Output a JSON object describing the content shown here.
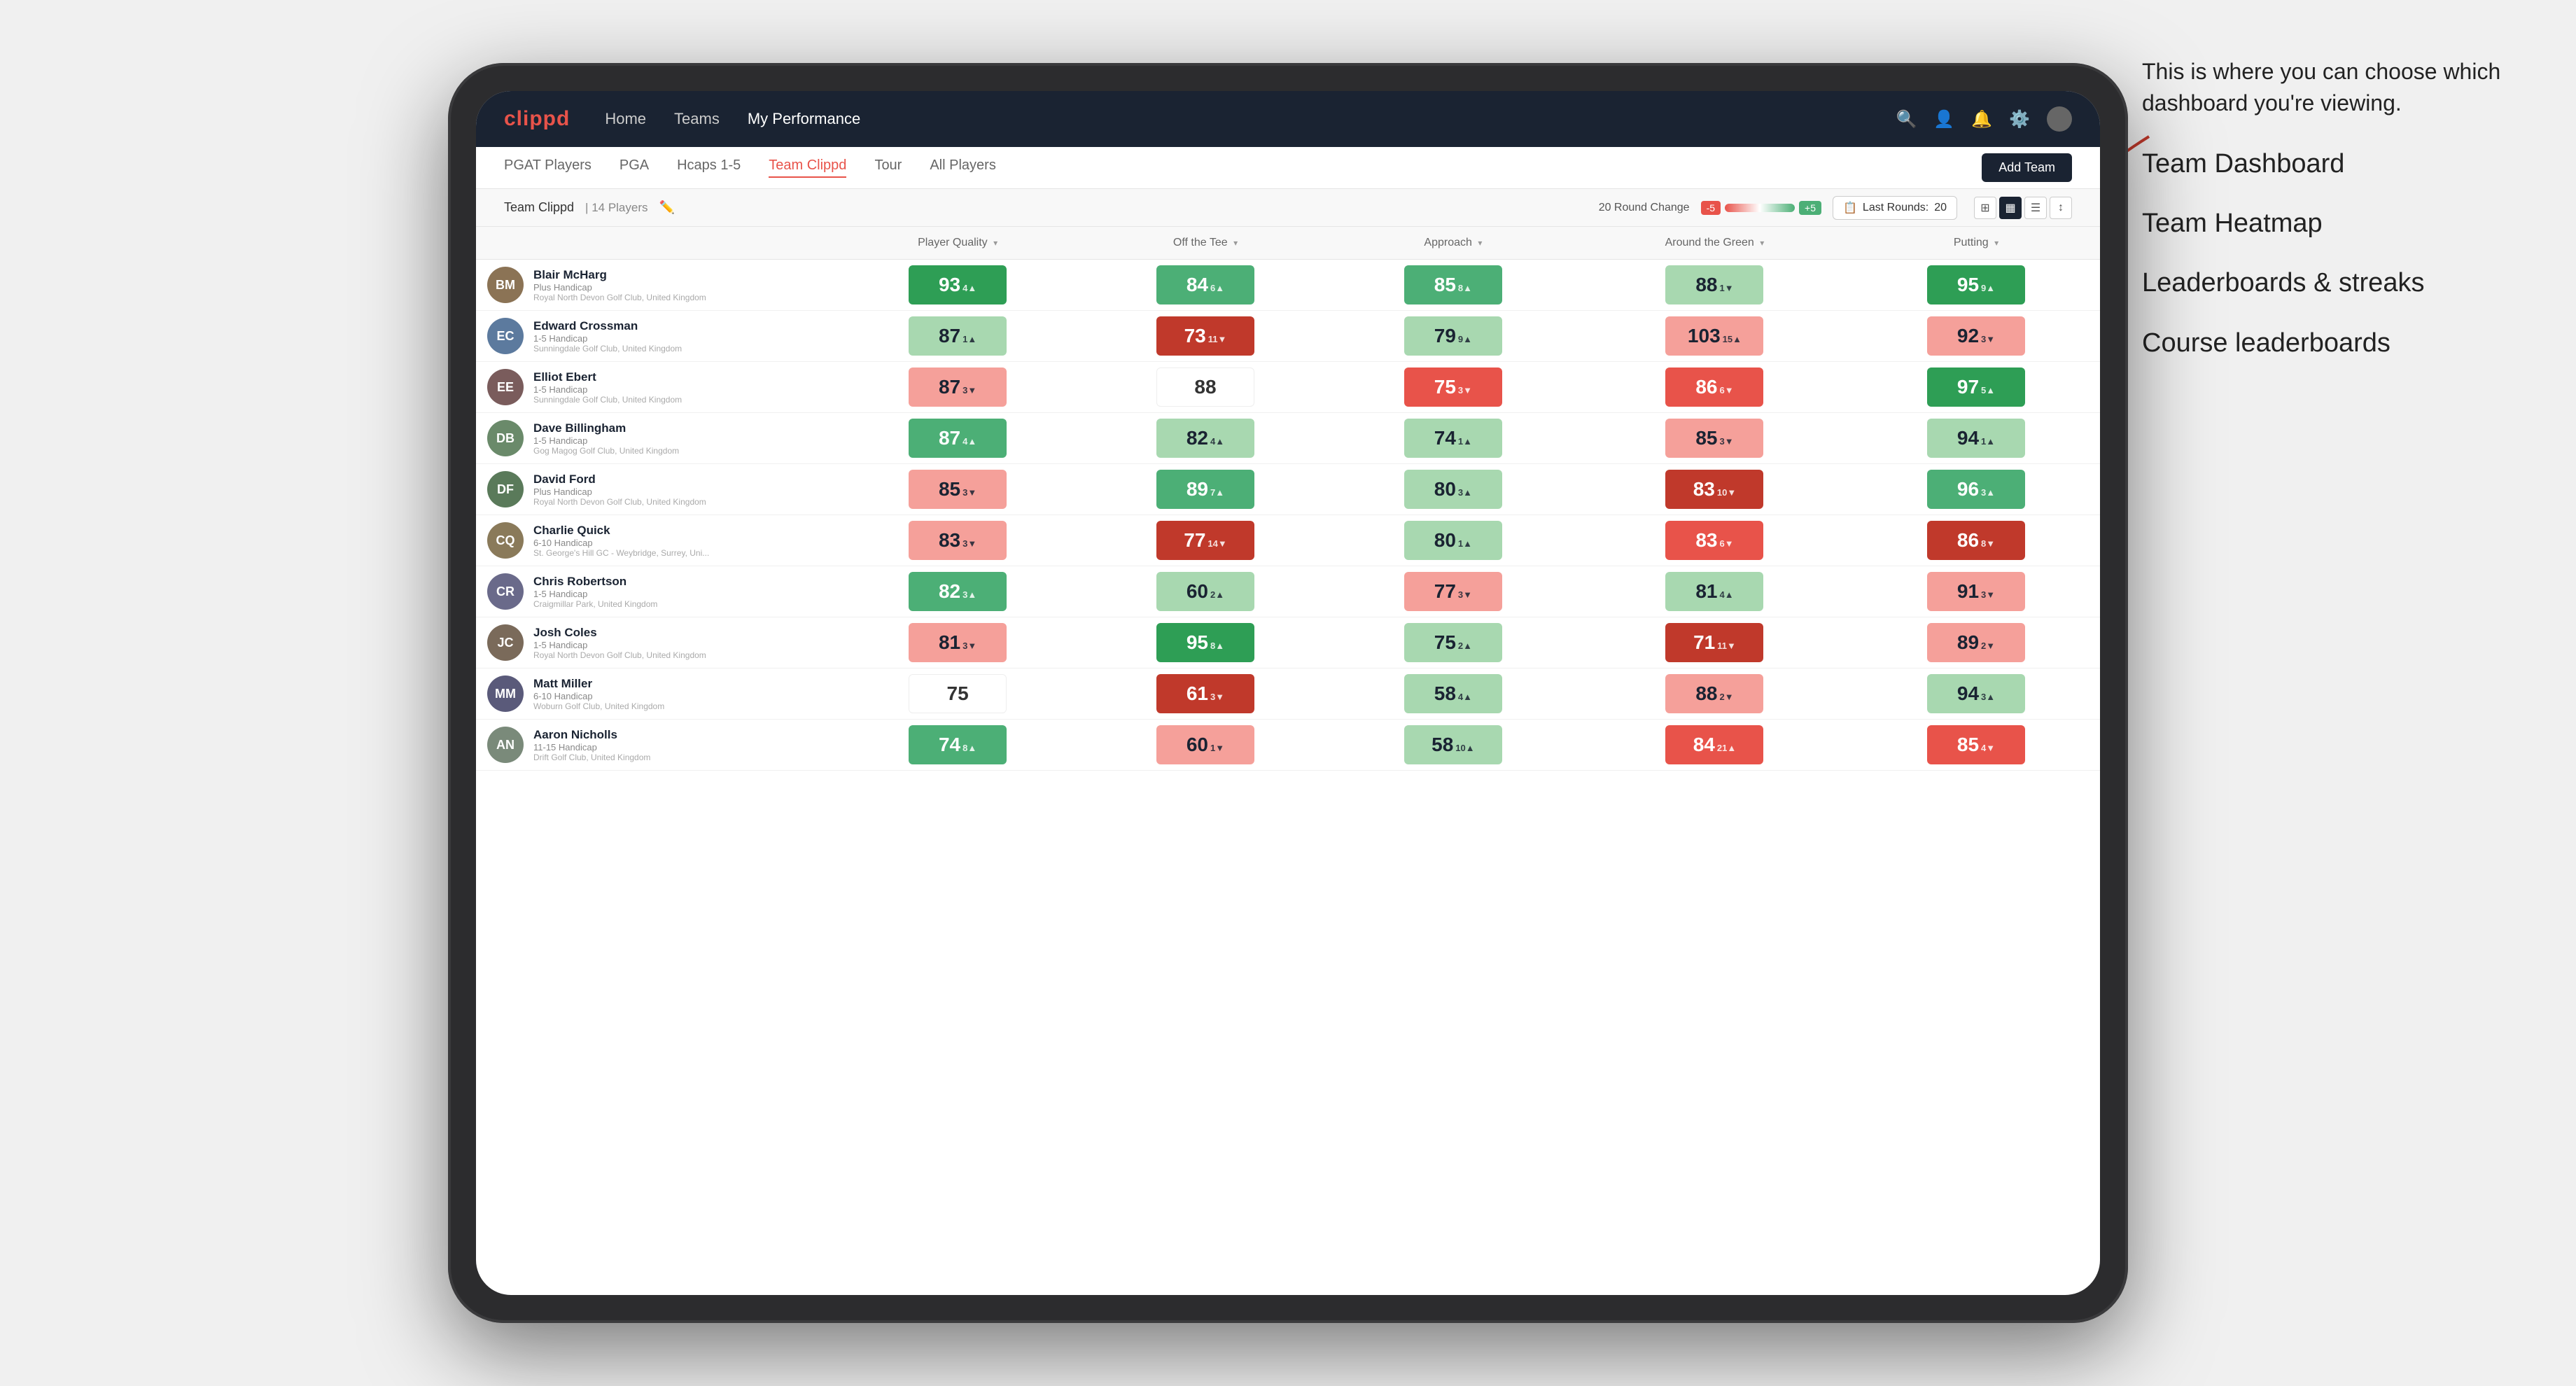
{
  "annotation": {
    "intro": "This is where you can choose which dashboard you're viewing.",
    "items": [
      "Team Dashboard",
      "Team Heatmap",
      "Leaderboards & streaks",
      "Course leaderboards"
    ]
  },
  "nav": {
    "logo": "clippd",
    "items": [
      "Home",
      "Teams",
      "My Performance"
    ],
    "active": "My Performance"
  },
  "sub_nav": {
    "items": [
      "PGAT Players",
      "PGA",
      "Hcaps 1-5",
      "Team Clippd",
      "Tour",
      "All Players"
    ],
    "active": "Team Clippd",
    "add_team": "Add Team"
  },
  "team_bar": {
    "team_name": "Team Clippd",
    "separator": "|",
    "player_count": "14 Players",
    "round_change_label": "20 Round Change",
    "badge_neg": "-5",
    "badge_pos": "+5",
    "last_rounds_label": "Last Rounds:",
    "last_rounds_value": "20"
  },
  "table": {
    "headers": {
      "player": "Player Quality",
      "off_tee": "Off the Tee",
      "approach": "Approach",
      "around": "Around the Green",
      "putting": "Putting"
    },
    "players": [
      {
        "name": "Blair McHarg",
        "handicap": "Plus Handicap",
        "club": "Royal North Devon Golf Club, United Kingdom",
        "initials": "BM",
        "avatar_color": "#8B7355",
        "scores": {
          "quality": {
            "value": "93",
            "delta": "4",
            "dir": "up",
            "color": "green-strong"
          },
          "off_tee": {
            "value": "84",
            "delta": "6",
            "dir": "up",
            "color": "green-med"
          },
          "approach": {
            "value": "85",
            "delta": "8",
            "dir": "up",
            "color": "green-med"
          },
          "around": {
            "value": "88",
            "delta": "1",
            "dir": "down",
            "color": "green-light"
          },
          "putting": {
            "value": "95",
            "delta": "9",
            "dir": "up",
            "color": "green-strong"
          }
        }
      },
      {
        "name": "Edward Crossman",
        "handicap": "1-5 Handicap",
        "club": "Sunningdale Golf Club, United Kingdom",
        "initials": "EC",
        "avatar_color": "#5c7a9e",
        "scores": {
          "quality": {
            "value": "87",
            "delta": "1",
            "dir": "up",
            "color": "green-light"
          },
          "off_tee": {
            "value": "73",
            "delta": "11",
            "dir": "down",
            "color": "red-strong"
          },
          "approach": {
            "value": "79",
            "delta": "9",
            "dir": "up",
            "color": "green-light"
          },
          "around": {
            "value": "103",
            "delta": "15",
            "dir": "up",
            "color": "red-light"
          },
          "putting": {
            "value": "92",
            "delta": "3",
            "dir": "down",
            "color": "red-light"
          }
        }
      },
      {
        "name": "Elliot Ebert",
        "handicap": "1-5 Handicap",
        "club": "Sunningdale Golf Club, United Kingdom",
        "initials": "EE",
        "avatar_color": "#7a5c5c",
        "scores": {
          "quality": {
            "value": "87",
            "delta": "3",
            "dir": "down",
            "color": "red-light"
          },
          "off_tee": {
            "value": "88",
            "delta": "",
            "dir": "",
            "color": "white"
          },
          "approach": {
            "value": "75",
            "delta": "3",
            "dir": "down",
            "color": "red-med"
          },
          "around": {
            "value": "86",
            "delta": "6",
            "dir": "down",
            "color": "red-med"
          },
          "putting": {
            "value": "97",
            "delta": "5",
            "dir": "up",
            "color": "green-strong"
          }
        }
      },
      {
        "name": "Dave Billingham",
        "handicap": "1-5 Handicap",
        "club": "Gog Magog Golf Club, United Kingdom",
        "initials": "DB",
        "avatar_color": "#6a8a6a",
        "scores": {
          "quality": {
            "value": "87",
            "delta": "4",
            "dir": "up",
            "color": "green-med"
          },
          "off_tee": {
            "value": "82",
            "delta": "4",
            "dir": "up",
            "color": "green-light"
          },
          "approach": {
            "value": "74",
            "delta": "1",
            "dir": "up",
            "color": "green-light"
          },
          "around": {
            "value": "85",
            "delta": "3",
            "dir": "down",
            "color": "red-light"
          },
          "putting": {
            "value": "94",
            "delta": "1",
            "dir": "up",
            "color": "green-light"
          }
        }
      },
      {
        "name": "David Ford",
        "handicap": "Plus Handicap",
        "club": "Royal North Devon Golf Club, United Kingdom",
        "initials": "DF",
        "avatar_color": "#5a7a5a",
        "scores": {
          "quality": {
            "value": "85",
            "delta": "3",
            "dir": "down",
            "color": "red-light"
          },
          "off_tee": {
            "value": "89",
            "delta": "7",
            "dir": "up",
            "color": "green-med"
          },
          "approach": {
            "value": "80",
            "delta": "3",
            "dir": "up",
            "color": "green-light"
          },
          "around": {
            "value": "83",
            "delta": "10",
            "dir": "down",
            "color": "red-strong"
          },
          "putting": {
            "value": "96",
            "delta": "3",
            "dir": "up",
            "color": "green-med"
          }
        }
      },
      {
        "name": "Charlie Quick",
        "handicap": "6-10 Handicap",
        "club": "St. George's Hill GC - Weybridge, Surrey, Uni...",
        "initials": "CQ",
        "avatar_color": "#8a7a5a",
        "scores": {
          "quality": {
            "value": "83",
            "delta": "3",
            "dir": "down",
            "color": "red-light"
          },
          "off_tee": {
            "value": "77",
            "delta": "14",
            "dir": "down",
            "color": "red-strong"
          },
          "approach": {
            "value": "80",
            "delta": "1",
            "dir": "up",
            "color": "green-light"
          },
          "around": {
            "value": "83",
            "delta": "6",
            "dir": "down",
            "color": "red-med"
          },
          "putting": {
            "value": "86",
            "delta": "8",
            "dir": "down",
            "color": "red-strong"
          }
        }
      },
      {
        "name": "Chris Robertson",
        "handicap": "1-5 Handicap",
        "club": "Craigmillar Park, United Kingdom",
        "initials": "CR",
        "avatar_color": "#6a6a8a",
        "scores": {
          "quality": {
            "value": "82",
            "delta": "3",
            "dir": "up",
            "color": "green-med"
          },
          "off_tee": {
            "value": "60",
            "delta": "2",
            "dir": "up",
            "color": "green-light"
          },
          "approach": {
            "value": "77",
            "delta": "3",
            "dir": "down",
            "color": "red-light"
          },
          "around": {
            "value": "81",
            "delta": "4",
            "dir": "up",
            "color": "green-light"
          },
          "putting": {
            "value": "91",
            "delta": "3",
            "dir": "down",
            "color": "red-light"
          }
        }
      },
      {
        "name": "Josh Coles",
        "handicap": "1-5 Handicap",
        "club": "Royal North Devon Golf Club, United Kingdom",
        "initials": "JC",
        "avatar_color": "#7a6a5a",
        "scores": {
          "quality": {
            "value": "81",
            "delta": "3",
            "dir": "down",
            "color": "red-light"
          },
          "off_tee": {
            "value": "95",
            "delta": "8",
            "dir": "up",
            "color": "green-strong"
          },
          "approach": {
            "value": "75",
            "delta": "2",
            "dir": "up",
            "color": "green-light"
          },
          "around": {
            "value": "71",
            "delta": "11",
            "dir": "down",
            "color": "red-strong"
          },
          "putting": {
            "value": "89",
            "delta": "2",
            "dir": "down",
            "color": "red-light"
          }
        }
      },
      {
        "name": "Matt Miller",
        "handicap": "6-10 Handicap",
        "club": "Woburn Golf Club, United Kingdom",
        "initials": "MM",
        "avatar_color": "#5a5a7a",
        "scores": {
          "quality": {
            "value": "75",
            "delta": "",
            "dir": "",
            "color": "white"
          },
          "off_tee": {
            "value": "61",
            "delta": "3",
            "dir": "down",
            "color": "red-strong"
          },
          "approach": {
            "value": "58",
            "delta": "4",
            "dir": "up",
            "color": "green-light"
          },
          "around": {
            "value": "88",
            "delta": "2",
            "dir": "down",
            "color": "red-light"
          },
          "putting": {
            "value": "94",
            "delta": "3",
            "dir": "up",
            "color": "green-light"
          }
        }
      },
      {
        "name": "Aaron Nicholls",
        "handicap": "11-15 Handicap",
        "club": "Drift Golf Club, United Kingdom",
        "initials": "AN",
        "avatar_color": "#7a8a7a",
        "scores": {
          "quality": {
            "value": "74",
            "delta": "8",
            "dir": "up",
            "color": "green-med"
          },
          "off_tee": {
            "value": "60",
            "delta": "1",
            "dir": "down",
            "color": "red-light"
          },
          "approach": {
            "value": "58",
            "delta": "10",
            "dir": "up",
            "color": "green-light"
          },
          "around": {
            "value": "84",
            "delta": "21",
            "dir": "up",
            "color": "red-med"
          },
          "putting": {
            "value": "85",
            "delta": "4",
            "dir": "down",
            "color": "red-med"
          }
        }
      }
    ]
  }
}
